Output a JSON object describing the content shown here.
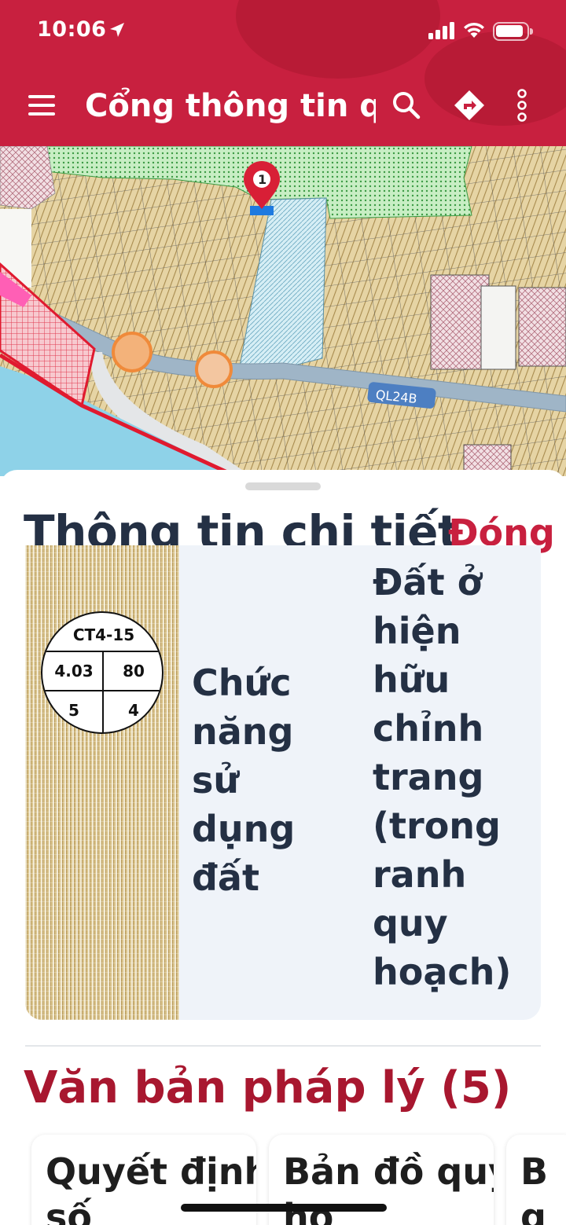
{
  "status_bar": {
    "time": "10:06"
  },
  "app_bar": {
    "title": "Cổng thông tin quy hoạch",
    "icons": [
      "menu-icon",
      "search-icon",
      "directions-icon",
      "more-vert-icon"
    ]
  },
  "map": {
    "marker_label": "1",
    "road_label": "QL24B"
  },
  "detail": {
    "title": "Thông tin chi tiết",
    "close_label": "Đóng",
    "zone": {
      "code": "CT4-15",
      "value_top_left": "4.03",
      "value_top_right": "80",
      "value_bottom_left": "5",
      "value_bottom_right": "4"
    },
    "function_label": "Chức năng sử dụng đất",
    "function_value": "Đất ở hiện hữu chỉnh trang (trong ranh quy hoạch)"
  },
  "legal": {
    "title": "Văn bản pháp lý (5)",
    "docs": [
      {
        "label": "Quyết định số"
      },
      {
        "label": "Bản đồ quy ho"
      },
      {
        "label": "B g"
      }
    ]
  },
  "colors": {
    "brand_red": "#c8203f",
    "legal_title": "#a8172f",
    "text_dark": "#243044",
    "residential_land": "#d9c38c",
    "green_zone": "#9fdca0",
    "water_zone": "#bfe3ef",
    "road": "#9fb5c7"
  }
}
